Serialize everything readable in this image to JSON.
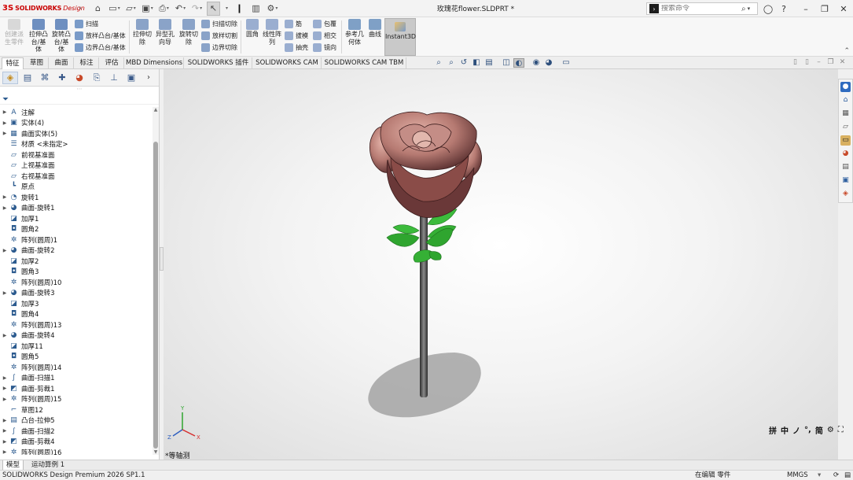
{
  "app": {
    "brand_prefix": "3S",
    "brand_bold": "SOLIDWORKS",
    "brand_italic": "Design",
    "document_title": "玫瑰花flower.SLDPRT *"
  },
  "search": {
    "placeholder": "搜索命令"
  },
  "ribbon": {
    "create_part": "创建派生零件",
    "extrude_boss": "拉伸凸台/基体",
    "revolve_boss": "旋转凸台/基体",
    "sweep": "扫描",
    "loft_boss": "放样凸台/基体",
    "boundary_boss": "边界凸台/基体",
    "extrude_cut": "拉伸切除",
    "hole_wizard": "异型孔向导",
    "revolve_cut": "旋转切除",
    "swept_cut": "扫描切除",
    "lofted_cut": "放样切割",
    "boundary_cut": "边界切除",
    "fillet": "圆角",
    "linear_pattern": "线性阵列",
    "rib": "筋",
    "draft": "拔模",
    "shell": "抽壳",
    "wrap": "包覆",
    "intersect": "相交",
    "mirror": "镜向",
    "reference_geometry": "参考几何体",
    "curves": "曲线",
    "instant3d": "Instant3D"
  },
  "tabs": [
    "特征",
    "草图",
    "曲面",
    "标注",
    "评估",
    "MBD Dimensions",
    "SOLIDWORKS 插件",
    "SOLIDWORKS CAM",
    "SOLIDWORKS CAM TBM"
  ],
  "tree": [
    {
      "label": "注解",
      "expand": true,
      "icon": "A"
    },
    {
      "label": "实体(4)",
      "expand": true,
      "icon": "▣"
    },
    {
      "label": "曲面实体(5)",
      "expand": true,
      "icon": "▦"
    },
    {
      "label": "材质 <未指定>",
      "expand": false,
      "icon": "☰"
    },
    {
      "label": "前视基准面",
      "expand": false,
      "icon": "▱"
    },
    {
      "label": "上视基准面",
      "expand": false,
      "icon": "▱"
    },
    {
      "label": "右视基准面",
      "expand": false,
      "icon": "▱"
    },
    {
      "label": "原点",
      "expand": false,
      "icon": "┗"
    },
    {
      "label": "旋转1",
      "expand": true,
      "icon": "◔"
    },
    {
      "label": "曲面-旋转1",
      "expand": true,
      "icon": "◕"
    },
    {
      "label": "加厚1",
      "expand": false,
      "icon": "◪"
    },
    {
      "label": "圆角2",
      "expand": false,
      "icon": "◘"
    },
    {
      "label": "阵列(圆周)1",
      "expand": false,
      "icon": "✲"
    },
    {
      "label": "曲面-旋转2",
      "expand": true,
      "icon": "◕"
    },
    {
      "label": "加厚2",
      "expand": false,
      "icon": "◪"
    },
    {
      "label": "圆角3",
      "expand": false,
      "icon": "◘"
    },
    {
      "label": "阵列(圆周)10",
      "expand": false,
      "icon": "✲"
    },
    {
      "label": "曲面-旋转3",
      "expand": true,
      "icon": "◕"
    },
    {
      "label": "加厚3",
      "expand": false,
      "icon": "◪"
    },
    {
      "label": "圆角4",
      "expand": false,
      "icon": "◘"
    },
    {
      "label": "阵列(圆周)13",
      "expand": false,
      "icon": "✲"
    },
    {
      "label": "曲面-旋转4",
      "expand": true,
      "icon": "◕"
    },
    {
      "label": "加厚11",
      "expand": false,
      "icon": "◪"
    },
    {
      "label": "圆角5",
      "expand": false,
      "icon": "◘"
    },
    {
      "label": "阵列(圆周)14",
      "expand": false,
      "icon": "✲"
    },
    {
      "label": "曲面-扫描1",
      "expand": true,
      "icon": "∫"
    },
    {
      "label": "曲面-剪裁1",
      "expand": true,
      "icon": "◩"
    },
    {
      "label": "阵列(圆周)15",
      "expand": true,
      "icon": "✲"
    },
    {
      "label": "草图12",
      "expand": false,
      "icon": "⌐"
    },
    {
      "label": "凸台-拉伸5",
      "expand": true,
      "icon": "▤"
    },
    {
      "label": "曲面-扫描2",
      "expand": true,
      "icon": "∫"
    },
    {
      "label": "曲面-剪裁4",
      "expand": true,
      "icon": "◩"
    },
    {
      "label": "阵列(圆周)16",
      "expand": true,
      "icon": "✲"
    }
  ],
  "viewport": {
    "view_label": "*等轴测",
    "triad_x": "X",
    "triad_y": "Y",
    "triad_z": "Z"
  },
  "ime": [
    "拼",
    "中",
    "ノ",
    "°,",
    "简",
    "⚙"
  ],
  "bottom_tabs": [
    "模型",
    "运动算例 1"
  ],
  "status": {
    "left": "SOLIDWORKS Design Premium 2026 SP1.1",
    "editing": "在编辑 零件",
    "units": "MMGS"
  },
  "colors": {
    "petal_light": "#c98e86",
    "petal_dark": "#5a3030",
    "leaf": "#2faa2f",
    "stem": "#4a4a4a",
    "accent_red": "#c80000"
  }
}
